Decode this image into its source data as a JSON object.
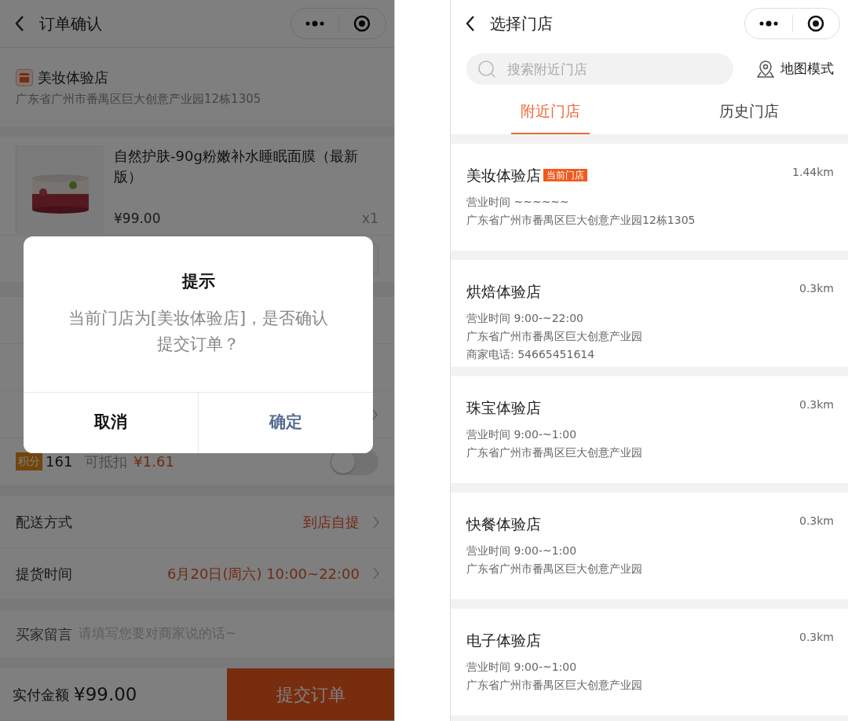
{
  "order_screen": {
    "title": "订单确认",
    "store": {
      "name": "美妆体验店",
      "address": "广东省广州市番禺区巨大创意产业园12栋1305"
    },
    "product": {
      "name": "自然护肤-90g粉嫩补水睡眠面膜（最新版）",
      "price": "¥99.00",
      "quantity": "x1"
    },
    "partial_rows": [
      {
        "kind": "plain"
      },
      {
        "kind": "plain"
      },
      {
        "kind": "link"
      }
    ],
    "points": {
      "badge": "积分",
      "amount": "161",
      "label": "可抵扣",
      "deduction": "¥1.61",
      "on": false
    },
    "detail_rows": [
      {
        "label": "配送方式",
        "value": "到店自提"
      },
      {
        "label": "提货时间",
        "value": "6月20日(周六) 10:00~22:00"
      }
    ],
    "message": {
      "label": "买家留言",
      "placeholder": "请填写您要对商家说的话~"
    },
    "footer": {
      "total_label": "实付金额",
      "total": "¥99.00",
      "submit": "提交订单"
    },
    "dialog": {
      "title": "提示",
      "message": "当前门店为[美妆体验店]，是否确认提交订单？",
      "buttons": [
        {
          "label": "取消",
          "kind": "cancel"
        },
        {
          "label": "确定",
          "kind": "confirm"
        }
      ]
    }
  },
  "store_screen": {
    "title": "选择门店",
    "search": {
      "placeholder": "搜索附近门店"
    },
    "map_mode": "地图模式",
    "tabs": [
      {
        "label": "附近门店",
        "selected": true
      },
      {
        "label": "历史门店",
        "selected": false
      }
    ],
    "stores": [
      {
        "name": "美妆体验店",
        "tag": "当前门店",
        "distance": "1.44km",
        "lines": [
          "营业时间 ~~~~~~",
          "广东省广州市番禺区巨大创意产业园12栋1305"
        ]
      },
      {
        "name": "烘焙体验店",
        "distance": "0.3km",
        "lines": [
          "营业时间 9:00-~22:00",
          "广东省广州市番禺区巨大创意产业园",
          "商家电话: 54665451614"
        ]
      },
      {
        "name": "珠宝体验店",
        "distance": "0.3km",
        "lines": [
          "营业时间 9:00-~1:00",
          "广东省广州市番禺区巨大创意产业园"
        ]
      },
      {
        "name": "快餐体验店",
        "distance": "0.3km",
        "lines": [
          "营业时间 9:00-~1:00",
          "广东省广州市番禺区巨大创意产业园"
        ]
      },
      {
        "name": "电子体验店",
        "distance": "0.3km",
        "lines": [
          "营业时间 9:00-~1:00",
          "广东省广州市番禺区巨大创意产业园"
        ]
      }
    ]
  }
}
